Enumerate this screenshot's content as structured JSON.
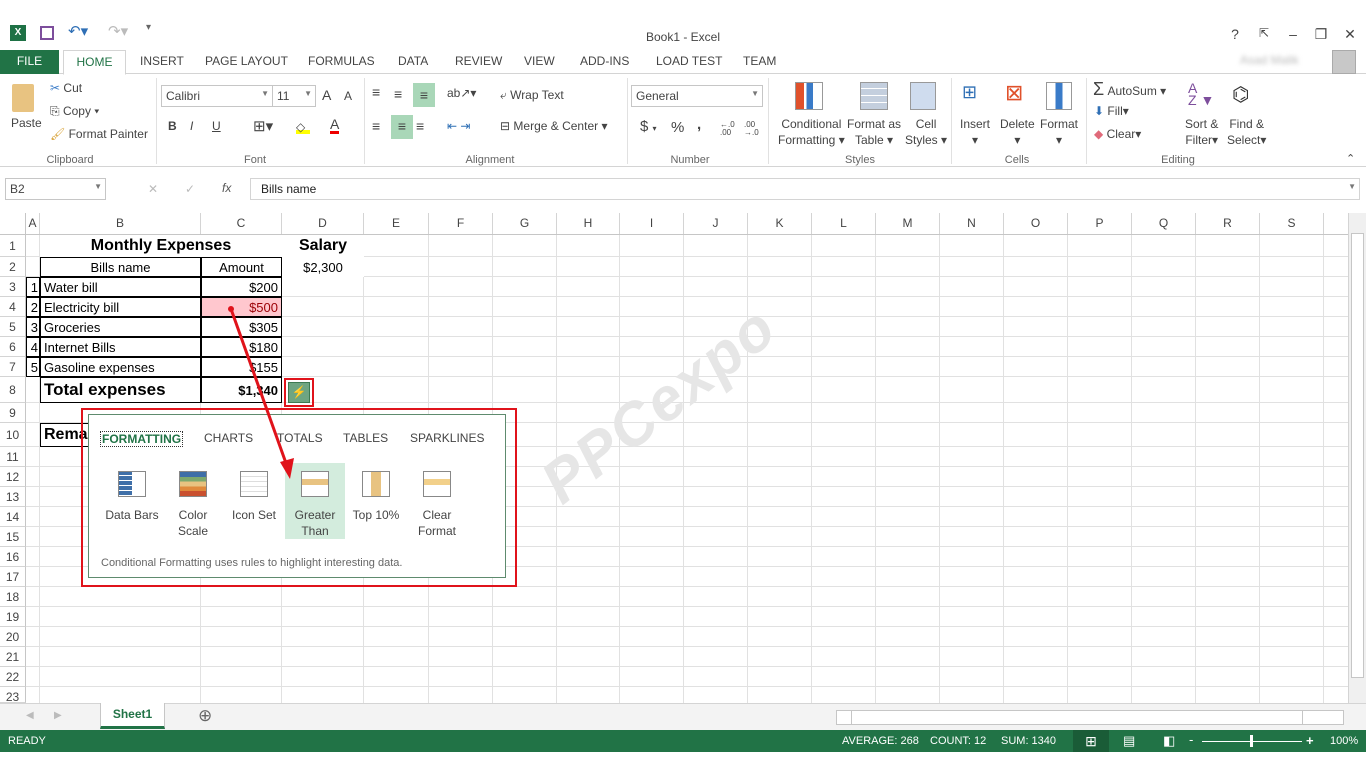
{
  "app": {
    "title": "Book1 - Excel",
    "user_name": "Asad Malik"
  },
  "window_controls": {
    "help": "?",
    "restore_ribbon": "⇱",
    "minimize": "–",
    "maximize": "❐",
    "close": "✕"
  },
  "quick_access": {
    "excel_icon": "excel-logo",
    "save_icon": "save-icon",
    "undo_icon": "undo-icon",
    "redo_icon": "redo-icon",
    "customize": "▾"
  },
  "tabs": [
    "FILE",
    "HOME",
    "INSERT",
    "PAGE LAYOUT",
    "FORMULAS",
    "DATA",
    "REVIEW",
    "VIEW",
    "ADD-INS",
    "LOAD TEST",
    "TEAM"
  ],
  "ribbon": {
    "clipboard": {
      "label": "Clipboard",
      "paste": "Paste",
      "cut": "Cut",
      "copy": "Copy",
      "format_painter": "Format Painter"
    },
    "font": {
      "label": "Font",
      "font_name": "Calibri",
      "font_size": "11",
      "bold": "B",
      "italic": "I",
      "underline": "U",
      "grow": "A",
      "shrink": "A",
      "font_color": "A"
    },
    "alignment": {
      "label": "Alignment",
      "wrap_text": "Wrap Text",
      "merge_center": "Merge & Center"
    },
    "number": {
      "label": "Number",
      "format": "General",
      "currency": "$",
      "percent": "%",
      "comma": ",",
      "inc_decimal": "←.0 .00",
      "dec_decimal": ".00 →.0"
    },
    "styles": {
      "label": "Styles",
      "conditional_formatting": [
        "Conditional",
        "Formatting"
      ],
      "format_as_table": [
        "Format as",
        "Table"
      ],
      "cell_styles": [
        "Cell",
        "Styles"
      ]
    },
    "cells": {
      "label": "Cells",
      "insert": "Insert",
      "delete": "Delete",
      "format": "Format"
    },
    "editing": {
      "label": "Editing",
      "autosum": "AutoSum",
      "fill": "Fill",
      "clear": "Clear",
      "sort_filter": [
        "Sort &",
        "Filter"
      ],
      "find_select": [
        "Find &",
        "Select"
      ]
    }
  },
  "formula_bar": {
    "name_box": "B2",
    "cancel": "✕",
    "enter": "✓",
    "fx": "fx",
    "value": "Bills name"
  },
  "columns": [
    "A",
    "B",
    "C",
    "D",
    "E",
    "F",
    "G",
    "H",
    "I",
    "J",
    "K",
    "L",
    "M",
    "N",
    "O",
    "P",
    "Q",
    "R",
    "S"
  ],
  "rows": [
    "1",
    "2",
    "3",
    "4",
    "5",
    "6",
    "7",
    "8",
    "9",
    "10",
    "11",
    "12",
    "13",
    "14",
    "15",
    "16",
    "17",
    "18",
    "19",
    "20",
    "21",
    "22",
    "23"
  ],
  "sheet": {
    "title": "Monthly Expenses",
    "salary_label": "Salary",
    "salary_value": "$2,300",
    "headers": [
      "Bills name",
      "Amount"
    ],
    "items": [
      {
        "no": "1",
        "name": "Water bill",
        "amount": "$200"
      },
      {
        "no": "2",
        "name": "Electricity bill",
        "amount": "$500"
      },
      {
        "no": "3",
        "name": "Groceries",
        "amount": "$305"
      },
      {
        "no": "4",
        "name": "Internet Bills",
        "amount": "$180"
      },
      {
        "no": "5",
        "name": "Gasoline expenses",
        "amount": "$155"
      }
    ],
    "total_label": "Total expenses",
    "total_value": "$1,340",
    "remaining_label": "Rema",
    "highlight_color": "#ffc7ce",
    "highlight_text_color": "#9c0006"
  },
  "quick_analysis": {
    "tabs": [
      "FORMATTING",
      "CHARTS",
      "TOTALS",
      "TABLES",
      "SPARKLINES"
    ],
    "active_tab": "FORMATTING",
    "items": [
      {
        "label": [
          "Data Bars",
          ""
        ],
        "icon": "data-bars-icon"
      },
      {
        "label": [
          "Color",
          "Scale"
        ],
        "icon": "color-scale-icon"
      },
      {
        "label": [
          "Icon Set",
          ""
        ],
        "icon": "icon-set-icon"
      },
      {
        "label": [
          "Greater",
          "Than"
        ],
        "icon": "greater-than-icon"
      },
      {
        "label": [
          "Top 10%",
          ""
        ],
        "icon": "top-10-icon"
      },
      {
        "label": [
          "Clear",
          "Format"
        ],
        "icon": "clear-format-icon"
      }
    ],
    "hovered": "Greater Than",
    "description": "Conditional Formatting uses rules to highlight interesting data."
  },
  "watermark": "PPCexpo",
  "sheet_tabs": {
    "active": "Sheet1",
    "add": "⊕"
  },
  "status_bar": {
    "ready": "READY",
    "average": "AVERAGE: 268",
    "count": "COUNT: 12",
    "sum": "SUM: 1340",
    "zoom": "100%",
    "zoom_level_percent": 100
  },
  "colors": {
    "accent": "#217346",
    "annotation_red": "#e0131b"
  }
}
